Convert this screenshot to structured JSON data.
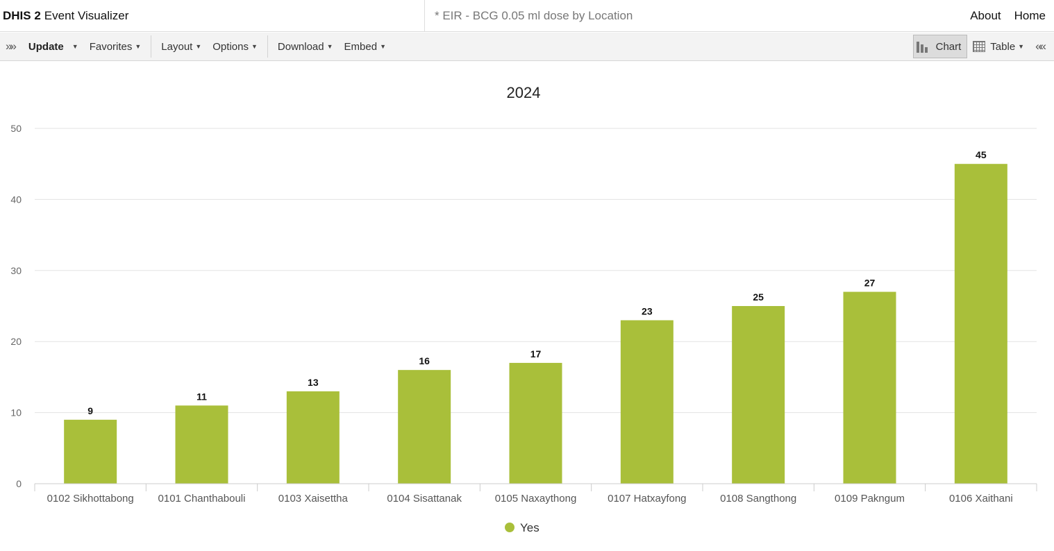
{
  "header": {
    "brand_bold": "DHIS 2",
    "brand_rest": "Event Visualizer",
    "favorite_title": "* EIR - BCG 0.05 ml dose by Location",
    "links": {
      "about": "About",
      "home": "Home"
    }
  },
  "toolbar": {
    "expand_icon": "»»",
    "update": "Update",
    "favorites": "Favorites",
    "layout": "Layout",
    "options": "Options",
    "download": "Download",
    "embed": "Embed",
    "chart": "Chart",
    "table": "Table",
    "collapse_icon": "««"
  },
  "colors": {
    "bar": "#a9bf3a",
    "grid": "#e3e3e3",
    "axis": "#cccccc"
  },
  "chart_data": {
    "type": "bar",
    "title": "2024",
    "categories": [
      "0102 Sikhottabong",
      "0101 Chanthabouli",
      "0103 Xaisettha",
      "0104 Sisattanak",
      "0105 Naxaythong",
      "0107 Hatxayfong",
      "0108 Sangthong",
      "0109 Pakngum",
      "0106 Xaithani"
    ],
    "series": [
      {
        "name": "Yes",
        "values": [
          9,
          11,
          13,
          16,
          17,
          23,
          25,
          27,
          45
        ]
      }
    ],
    "ylim": [
      0,
      50
    ],
    "yticks": [
      0,
      10,
      20,
      30,
      40,
      50
    ],
    "grid": true,
    "data_labels": true,
    "legend": "bottom-center",
    "xlabel": "",
    "ylabel": ""
  }
}
